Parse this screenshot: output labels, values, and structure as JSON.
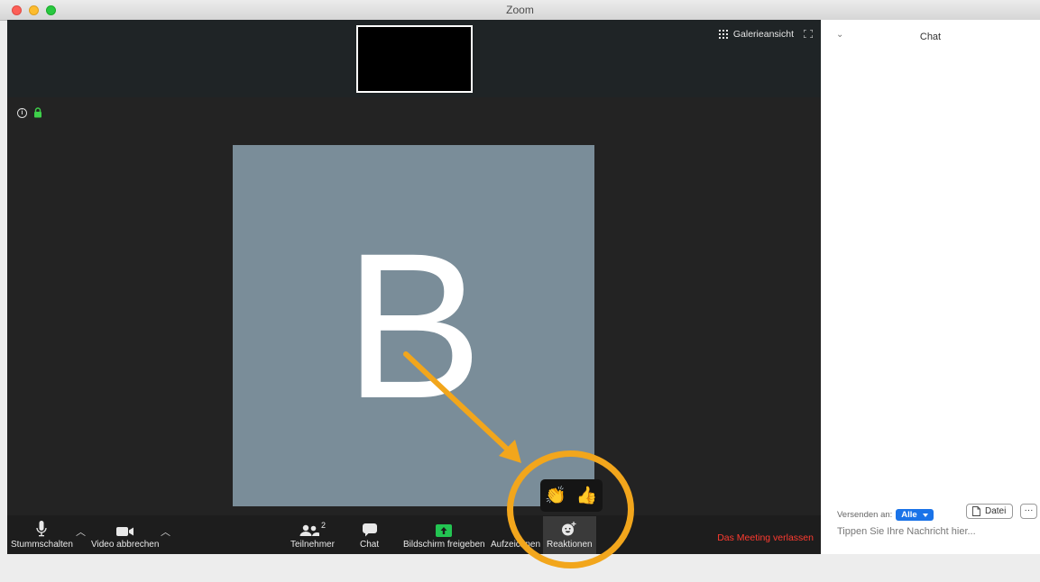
{
  "window": {
    "title": "Zoom"
  },
  "topbar": {
    "gallery_label": "Galerieansicht"
  },
  "avatar": {
    "initial": "B",
    "tile_color": "#7a8d99"
  },
  "toolbar": {
    "mute_label": "Stummschalten",
    "video_label": "Video abbrechen",
    "participants_label": "Teilnehmer",
    "participants_count": "2",
    "chat_label": "Chat",
    "share_label": "Bildschirm freigeben",
    "record_label": "Aufzeichnen",
    "reactions_label": "Reaktionen",
    "leave_label": "Das Meeting verlassen"
  },
  "reactions": {
    "clap": "👏",
    "thumbs_up": "👍"
  },
  "chat": {
    "title": "Chat",
    "send_to_label": "Versenden an:",
    "recipient": "Alle",
    "file_label": "Datei",
    "more_label": "···",
    "input_placeholder": "Tippen Sie Ihre Nachricht hier..."
  },
  "colors": {
    "accent_orange": "#f2a61c",
    "leave_red": "#ff3b30",
    "share_green": "#23c552",
    "recipient_blue": "#1a73e8"
  }
}
